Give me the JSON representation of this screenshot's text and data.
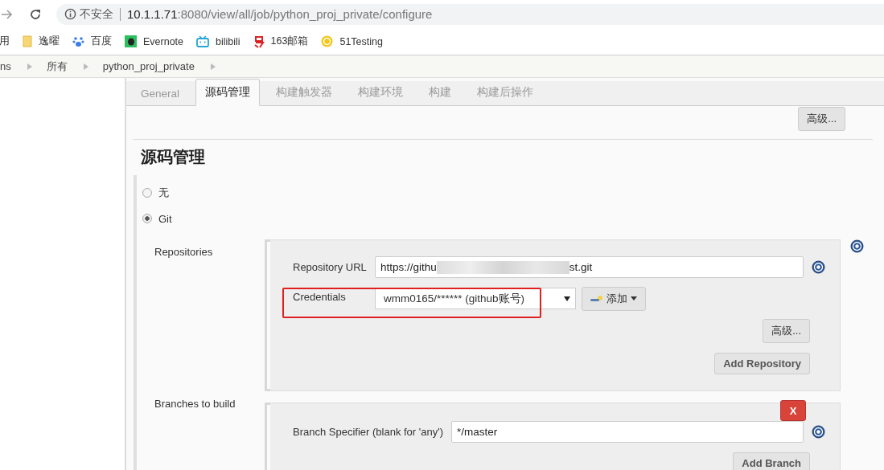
{
  "browser": {
    "security_label": "不安全",
    "url_host": "10.1.1.71",
    "url_path": ":8080/view/all/job/python_proj_private/configure"
  },
  "bookmarks": [
    {
      "label": "用",
      "kind": "none"
    },
    {
      "label": "逸曜",
      "kind": "folder"
    },
    {
      "label": "百度",
      "kind": "paw"
    },
    {
      "label": "Evernote",
      "kind": "elephant"
    },
    {
      "label": "bilibili",
      "kind": "tv"
    },
    {
      "label": "163邮箱",
      "kind": "mail163"
    },
    {
      "label": "51Testing",
      "kind": "coin"
    }
  ],
  "breadcrumbs": [
    "ns",
    "所有",
    "python_proj_private"
  ],
  "tabs": [
    {
      "label": "General",
      "selected": false
    },
    {
      "label": "源码管理",
      "selected": true
    },
    {
      "label": "构建触发器",
      "selected": false
    },
    {
      "label": "构建环境",
      "selected": false
    },
    {
      "label": "构建",
      "selected": false
    },
    {
      "label": "构建后操作",
      "selected": false
    }
  ],
  "top_advanced_button": "高级...",
  "section_title": "源码管理",
  "scm_options": [
    {
      "label": "无",
      "selected": false
    },
    {
      "label": "Git",
      "selected": true
    }
  ],
  "repositories": {
    "label": "Repositories",
    "url_label": "Repository URL",
    "url_start": "https://githu",
    "url_end": "st.git",
    "credentials_label": "Credentials",
    "credentials_value": "wmm0165/****** (github账号)",
    "add_label": "添加",
    "advanced_button": "高级...",
    "add_repository_button": "Add Repository"
  },
  "branches": {
    "label": "Branches to build",
    "delete_button": "X",
    "specifier_label": "Branch Specifier (blank for 'any')",
    "specifier_value": "*/master",
    "add_branch_button": "Add Branch"
  }
}
